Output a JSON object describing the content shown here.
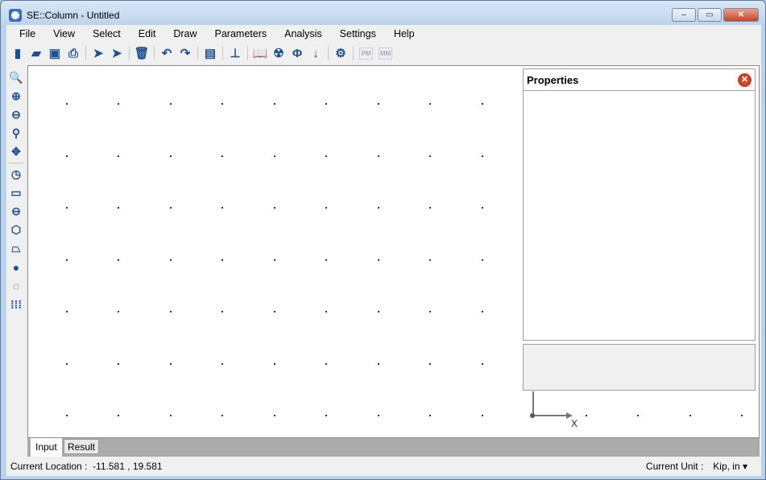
{
  "window": {
    "title": "SE::Column - Untitled",
    "min": "‒",
    "max": "▭",
    "close": "✕"
  },
  "menu": [
    "File",
    "View",
    "Select",
    "Edit",
    "Draw",
    "Parameters",
    "Analysis",
    "Settings",
    "Help"
  ],
  "toolbar": [
    {
      "icon": "new-icon",
      "glyph": "▮"
    },
    {
      "icon": "open-folder-icon",
      "glyph": "▰"
    },
    {
      "icon": "save-icon",
      "glyph": "▣"
    },
    {
      "icon": "print-icon",
      "glyph": "⎙"
    },
    {
      "sep": true
    },
    {
      "icon": "select-pointer-icon",
      "glyph": "➤"
    },
    {
      "icon": "select-node-icon",
      "glyph": "➤"
    },
    {
      "sep": true
    },
    {
      "icon": "delete-icon",
      "glyph": "🗑"
    },
    {
      "sep": true
    },
    {
      "icon": "undo-icon",
      "glyph": "↶"
    },
    {
      "icon": "redo-icon",
      "glyph": "↷"
    },
    {
      "sep": true
    },
    {
      "icon": "report-icon",
      "glyph": "▤"
    },
    {
      "sep": true
    },
    {
      "icon": "hierarchy-icon",
      "glyph": "⊥"
    },
    {
      "sep": true
    },
    {
      "icon": "book-icon",
      "glyph": "📖"
    },
    {
      "icon": "radiation-icon",
      "glyph": "☢"
    },
    {
      "icon": "phi-icon",
      "glyph": "Φ"
    },
    {
      "icon": "load-arrow-down-icon",
      "glyph": "↓"
    },
    {
      "sep": true
    },
    {
      "icon": "settings-gears-icon",
      "glyph": "⚙"
    },
    {
      "sep": true
    },
    {
      "icon": "pm-diagram-icon",
      "glyph": "PM",
      "disabled": true
    },
    {
      "icon": "mm-diagram-icon",
      "glyph": "MM",
      "disabled": true
    }
  ],
  "left_toolbar": [
    {
      "icon": "zoom-all-icon",
      "glyph": "🔍"
    },
    {
      "icon": "zoom-in-icon",
      "glyph": "⊕"
    },
    {
      "icon": "zoom-out-icon",
      "glyph": "⊖"
    },
    {
      "icon": "zoom-window-icon",
      "glyph": "⚲"
    },
    {
      "icon": "pan-icon",
      "glyph": "✥"
    },
    {
      "sep": true
    },
    {
      "icon": "circle-section-icon",
      "glyph": "◷"
    },
    {
      "icon": "rectangle-section-icon",
      "glyph": "▭"
    },
    {
      "icon": "circle-hole-icon",
      "glyph": "⊖"
    },
    {
      "icon": "polygon-icon",
      "glyph": "⬡"
    },
    {
      "icon": "custom-shape-icon",
      "glyph": "⏢"
    },
    {
      "icon": "single-bar-icon",
      "glyph": "●"
    },
    {
      "icon": "circular-bars-icon",
      "glyph": "◌"
    },
    {
      "icon": "rectangular-bars-icon",
      "glyph": "⁞⁞⁞"
    }
  ],
  "properties": {
    "title": "Properties"
  },
  "axis": {
    "x_label": "X"
  },
  "tabs": [
    "Input",
    "Result"
  ],
  "status": {
    "location_label": "Current Location :",
    "location_value": "-11.581 , 19.581",
    "unit_label": "Current Unit :",
    "unit_value": "Kip, in ▾"
  }
}
